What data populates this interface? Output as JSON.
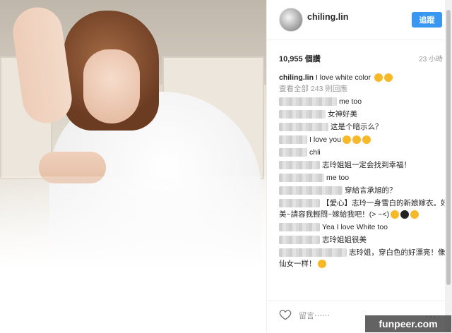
{
  "header": {
    "username": "chiling.lin",
    "follow_label": "追蹤"
  },
  "stats": {
    "likes": "10,955 個讚",
    "time": "23 小時"
  },
  "caption": {
    "username": "chiling.lin",
    "text": "I love white color"
  },
  "view_all": "查看全部 243 則回應",
  "comments": [
    {
      "text": "me too"
    },
    {
      "text": "女神好美"
    },
    {
      "text": "这是个暗示么？"
    },
    {
      "text": "I love you"
    },
    {
      "text": "chli"
    },
    {
      "text": "志玲姐姐一定会找到幸福！"
    },
    {
      "text": "me too"
    },
    {
      "text": "穿給言承旭的？"
    },
    {
      "text": "【愛心】志玲一身雪白的新娘嫁衣。好美~請容我輕問~嫁給我吧！(> ~<)"
    },
    {
      "text": "Yea I love White too"
    },
    {
      "text": "志玲姐姐很美"
    },
    {
      "text": "志玲姐，穿白色的好漂亮！像仙女一样！"
    }
  ],
  "footer": {
    "comment_placeholder": "留言⋯⋯",
    "more": "..."
  },
  "watermark": "funpeer.com"
}
